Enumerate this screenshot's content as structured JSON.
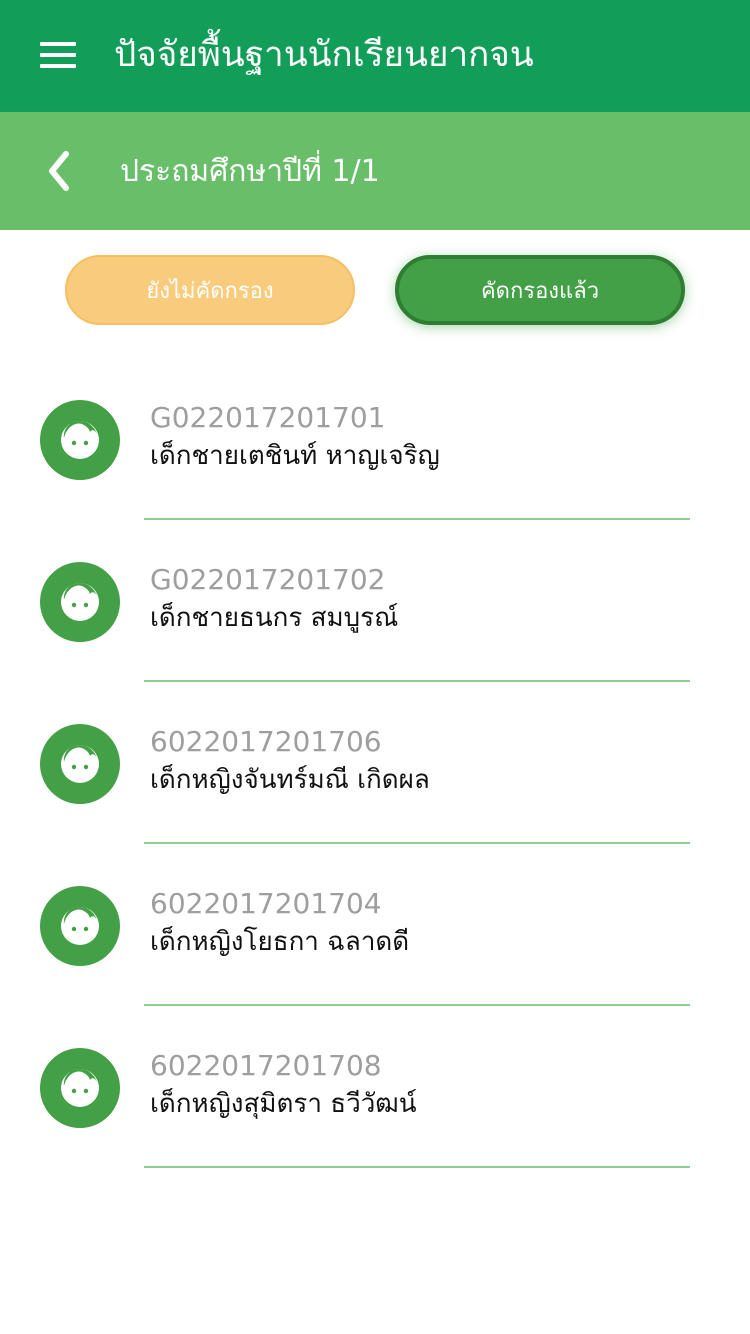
{
  "header": {
    "title": "ปัจจัยพื้นฐานนักเรียนยากจน",
    "menu_icon": "hamburger-menu-icon"
  },
  "subheader": {
    "title": "ประถมศึกษาปีที่ 1/1",
    "back_icon": "chevron-left-icon"
  },
  "filter": {
    "pending_label": "ยังไม่คัดกรอง",
    "done_label": "คัดกรองแล้ว",
    "selected": "done"
  },
  "students": [
    {
      "id": "G022017201701",
      "name": "เด็กชายเตชินท์ หาญเจริญ"
    },
    {
      "id": "G022017201702",
      "name": "เด็กชายธนกร สมบูรณ์"
    },
    {
      "id": "6022017201706",
      "name": "เด็กหญิงจันทร์มณี เกิดผล"
    },
    {
      "id": "6022017201704",
      "name": "เด็กหญิงโยธกา ฉลาดดี"
    },
    {
      "id": "6022017201708",
      "name": "เด็กหญิงสุมิตรา ธวีวัฒน์"
    }
  ],
  "colors": {
    "primary": "#129e58",
    "secondary": "#69be6a",
    "accent": "#43a047",
    "pending": "#f9cc7d"
  }
}
